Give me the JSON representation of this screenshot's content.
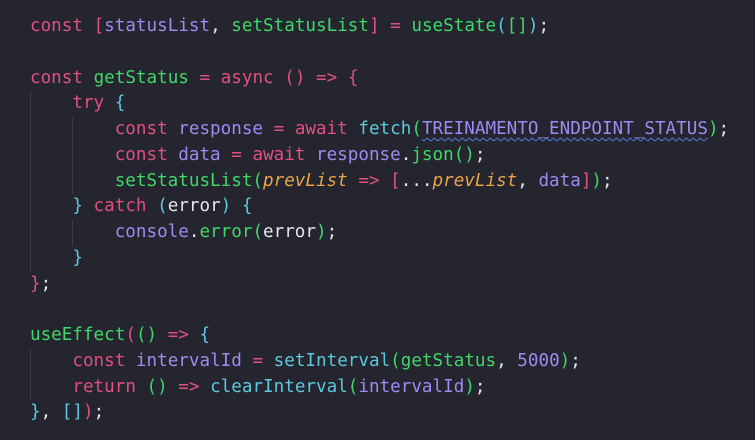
{
  "editor": {
    "language": "javascript",
    "colors": {
      "background": "#24252f",
      "keyword": "#e2507f",
      "variable": "#9d8cf0",
      "function": "#3fd868",
      "builtin_function": "#5cc9dc",
      "parameter": "#e8a446",
      "plain": "#e4e4ea"
    },
    "lines": [
      {
        "indent": 0,
        "tokens": [
          [
            "const",
            "k"
          ],
          [
            " ",
            "p"
          ],
          [
            "[",
            "b1"
          ],
          [
            "statusList",
            "v"
          ],
          [
            ", ",
            "p"
          ],
          [
            "setStatusList",
            "f"
          ],
          [
            "]",
            "b1"
          ],
          [
            " = ",
            "o"
          ],
          [
            "useState",
            "f"
          ],
          [
            "(",
            "b2"
          ],
          [
            "[",
            "b3"
          ],
          [
            "]",
            "b3"
          ],
          [
            ")",
            "b2"
          ],
          [
            ";",
            "p"
          ]
        ]
      },
      {
        "indent": 0,
        "tokens": []
      },
      {
        "indent": 0,
        "tokens": [
          [
            "const",
            "k"
          ],
          [
            " ",
            "p"
          ],
          [
            "getStatus",
            "f"
          ],
          [
            " = ",
            "o"
          ],
          [
            "async",
            "k"
          ],
          [
            " ",
            "p"
          ],
          [
            "()",
            "b1"
          ],
          [
            " => ",
            "o"
          ],
          [
            "{",
            "b1"
          ]
        ]
      },
      {
        "indent": 1,
        "tokens": [
          [
            "try",
            "k"
          ],
          [
            " ",
            "p"
          ],
          [
            "{",
            "b2"
          ]
        ]
      },
      {
        "indent": 2,
        "tokens": [
          [
            "const",
            "k"
          ],
          [
            " ",
            "p"
          ],
          [
            "response",
            "v"
          ],
          [
            " = ",
            "o"
          ],
          [
            "await",
            "k"
          ],
          [
            " ",
            "p"
          ],
          [
            "fetch",
            "c"
          ],
          [
            "(",
            "b3"
          ],
          [
            "TREINAMENTO_ENDPOINT_STATUS",
            "v squiggle"
          ],
          [
            ")",
            "b3"
          ],
          [
            ";",
            "p"
          ]
        ]
      },
      {
        "indent": 2,
        "tokens": [
          [
            "const",
            "k"
          ],
          [
            " ",
            "p"
          ],
          [
            "data",
            "v"
          ],
          [
            " = ",
            "o"
          ],
          [
            "await",
            "k"
          ],
          [
            " ",
            "p"
          ],
          [
            "response",
            "v"
          ],
          [
            ".",
            "p"
          ],
          [
            "json",
            "f"
          ],
          [
            "()",
            "b3"
          ],
          [
            ";",
            "p"
          ]
        ]
      },
      {
        "indent": 2,
        "tokens": [
          [
            "setStatusList",
            "f"
          ],
          [
            "(",
            "b3"
          ],
          [
            "prevList",
            "i"
          ],
          [
            " => ",
            "o"
          ],
          [
            "[",
            "b1"
          ],
          [
            "...",
            "p"
          ],
          [
            "prevList",
            "i"
          ],
          [
            ", ",
            "p"
          ],
          [
            "data",
            "v"
          ],
          [
            "]",
            "b1"
          ],
          [
            ")",
            "b3"
          ],
          [
            ";",
            "p"
          ]
        ]
      },
      {
        "indent": 1,
        "tokens": [
          [
            "}",
            "b2"
          ],
          [
            " ",
            "p"
          ],
          [
            "catch",
            "k"
          ],
          [
            " ",
            "p"
          ],
          [
            "(",
            "b2"
          ],
          [
            "error",
            "p"
          ],
          [
            ")",
            "b2"
          ],
          [
            " ",
            "p"
          ],
          [
            "{",
            "b2"
          ]
        ]
      },
      {
        "indent": 2,
        "tokens": [
          [
            "console",
            "v"
          ],
          [
            ".",
            "p"
          ],
          [
            "error",
            "f"
          ],
          [
            "(",
            "b3"
          ],
          [
            "error",
            "p"
          ],
          [
            ")",
            "b3"
          ],
          [
            ";",
            "p"
          ]
        ]
      },
      {
        "indent": 1,
        "tokens": [
          [
            "}",
            "b2"
          ]
        ]
      },
      {
        "indent": 0,
        "tokens": [
          [
            "}",
            "b1"
          ],
          [
            ";",
            "p"
          ]
        ]
      },
      {
        "indent": 0,
        "tokens": []
      },
      {
        "indent": 0,
        "tokens": [
          [
            "useEffect",
            "f"
          ],
          [
            "(",
            "b1"
          ],
          [
            "()",
            "b3"
          ],
          [
            " => ",
            "o"
          ],
          [
            "{",
            "b2"
          ]
        ]
      },
      {
        "indent": 1,
        "tokens": [
          [
            "const",
            "k"
          ],
          [
            " ",
            "p"
          ],
          [
            "intervalId",
            "v"
          ],
          [
            " = ",
            "o"
          ],
          [
            "setInterval",
            "c"
          ],
          [
            "(",
            "b3"
          ],
          [
            "getStatus",
            "f"
          ],
          [
            ", ",
            "p"
          ],
          [
            "5000",
            "n"
          ],
          [
            ")",
            "b3"
          ],
          [
            ";",
            "p"
          ]
        ]
      },
      {
        "indent": 1,
        "tokens": [
          [
            "return",
            "k"
          ],
          [
            " ",
            "p"
          ],
          [
            "()",
            "b3"
          ],
          [
            " => ",
            "o"
          ],
          [
            "clearInterval",
            "c"
          ],
          [
            "(",
            "b3"
          ],
          [
            "intervalId",
            "v"
          ],
          [
            ")",
            "b3"
          ],
          [
            ";",
            "p"
          ]
        ]
      },
      {
        "indent": 0,
        "tokens": [
          [
            "}",
            "b2"
          ],
          [
            ", ",
            "p"
          ],
          [
            "[",
            "b2"
          ],
          [
            "]",
            "b2"
          ],
          [
            ")",
            "b1"
          ],
          [
            ";",
            "p"
          ]
        ]
      }
    ]
  }
}
